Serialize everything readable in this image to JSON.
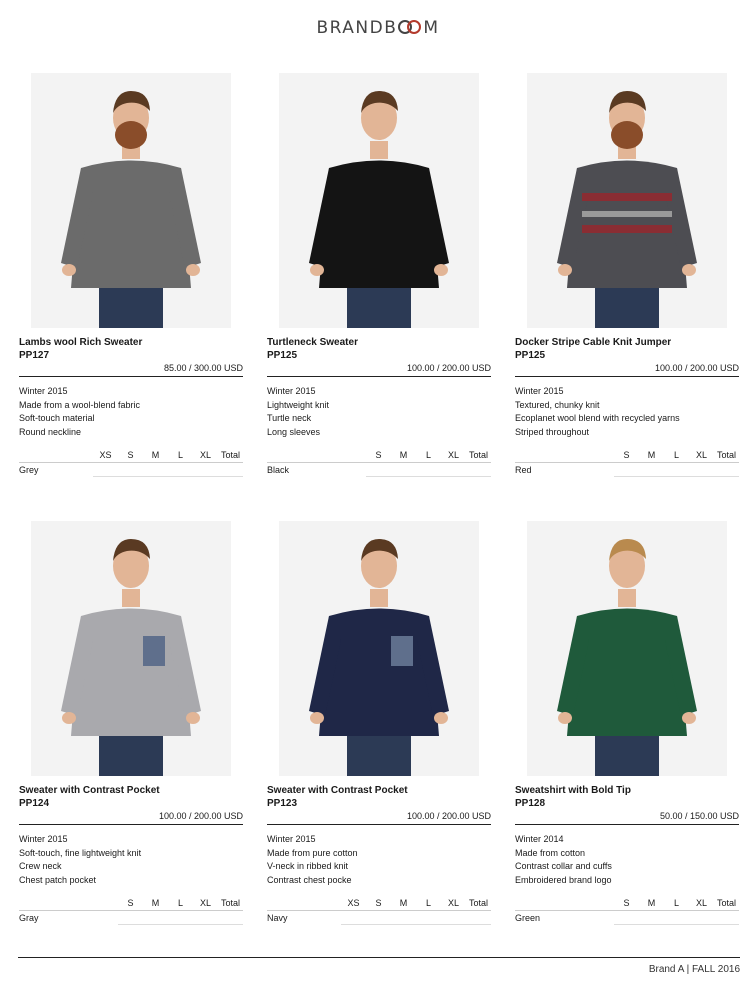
{
  "brand": {
    "logo_prefix": "BRANDB",
    "logo_suffix": "M"
  },
  "products": [
    {
      "name": "Lambs wool Rich Sweater",
      "code": "PP127",
      "price": "85.00 / 300.00 USD",
      "details": [
        "Winter 2015",
        "Made from a wool-blend fabric",
        "Soft-touch material",
        "Round neckline"
      ],
      "sizes": [
        "XS",
        "S",
        "M",
        "L",
        "XL",
        "Total"
      ],
      "color": "Grey",
      "swatch": "#6b6b6b"
    },
    {
      "name": "Turtleneck Sweater",
      "code": "PP125",
      "price": "100.00 / 200.00 USD",
      "details": [
        "Winter 2015",
        "Lightweight knit",
        "Turtle neck",
        "Long sleeves"
      ],
      "sizes": [
        "S",
        "M",
        "L",
        "XL",
        "Total"
      ],
      "color": "Black",
      "swatch": "#141414"
    },
    {
      "name": "Docker Stripe Cable Knit Jumper",
      "code": "PP125",
      "price": "100.00 / 200.00 USD",
      "details": [
        "Winter 2015",
        "Textured, chunky knit",
        "Ecoplanet wool blend with recycled yarns",
        "Striped throughout"
      ],
      "sizes": [
        "S",
        "M",
        "L",
        "XL",
        "Total"
      ],
      "color": "Red",
      "swatch": "#4d4d52"
    },
    {
      "name": "Sweater with Contrast Pocket",
      "code": "PP124",
      "price": "100.00 / 200.00 USD",
      "details": [
        "Winter 2015",
        "Soft-touch, fine lightweight knit",
        "Crew neck",
        "Chest patch pocket"
      ],
      "sizes": [
        "S",
        "M",
        "L",
        "XL",
        "Total"
      ],
      "color": "Gray",
      "swatch": "#a9a9ad"
    },
    {
      "name": "Sweater with Contrast Pocket",
      "code": "PP123",
      "price": "100.00 / 200.00 USD",
      "details": [
        "Winter 2015",
        "Made from pure cotton",
        "V-neck in ribbed knit",
        "Contrast chest pocke"
      ],
      "sizes": [
        "XS",
        "S",
        "M",
        "L",
        "XL",
        "Total"
      ],
      "color": "Navy",
      "swatch": "#1f2747"
    },
    {
      "name": "Sweatshirt with Bold Tip",
      "code": "PP128",
      "price": "50.00 / 150.00 USD",
      "details": [
        "Winter 2014",
        "Made from cotton",
        "Contrast collar and cuffs",
        "Embroidered brand logo"
      ],
      "sizes": [
        "S",
        "M",
        "L",
        "XL",
        "Total"
      ],
      "color": "Green",
      "swatch": "#1f5a3b"
    }
  ],
  "footer": {
    "text": "Brand A | FALL 2016"
  }
}
